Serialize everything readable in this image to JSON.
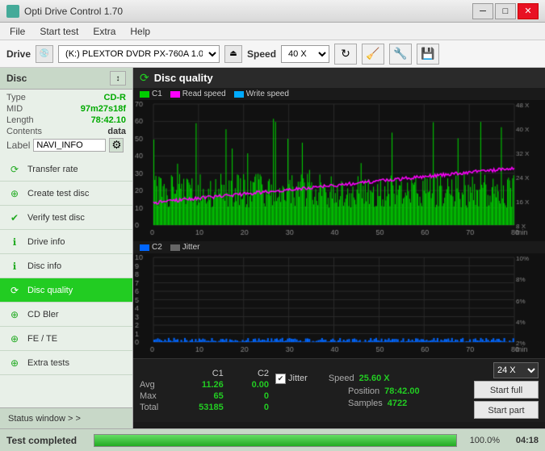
{
  "titleBar": {
    "icon": "💿",
    "title": "Opti Drive Control 1.70",
    "minimize": "─",
    "maximize": "□",
    "close": "✕"
  },
  "menuBar": {
    "items": [
      "File",
      "Start test",
      "Extra",
      "Help"
    ]
  },
  "driveBar": {
    "label": "Drive",
    "driveValue": "(K:)  PLEXTOR DVDR   PX-760A 1.07",
    "speedLabel": "Speed",
    "speedValue": "40 X"
  },
  "leftPanel": {
    "discHeader": "Disc",
    "discInfo": {
      "typeLabel": "Type",
      "typeValue": "CD-R",
      "midLabel": "MID",
      "midValue": "97m27s18f",
      "lengthLabel": "Length",
      "lengthValue": "78:42.10",
      "contentsLabel": "Contents",
      "contentsValue": "data",
      "labelLabel": "Label",
      "labelValue": "NAVI_INFO"
    },
    "navItems": [
      {
        "id": "transfer-rate",
        "label": "Transfer rate",
        "active": false
      },
      {
        "id": "create-test-disc",
        "label": "Create test disc",
        "active": false
      },
      {
        "id": "verify-test-disc",
        "label": "Verify test disc",
        "active": false
      },
      {
        "id": "drive-info",
        "label": "Drive info",
        "active": false
      },
      {
        "id": "disc-info",
        "label": "Disc info",
        "active": false
      },
      {
        "id": "disc-quality",
        "label": "Disc quality",
        "active": true
      },
      {
        "id": "cd-bler",
        "label": "CD Bler",
        "active": false
      },
      {
        "id": "fe-te",
        "label": "FE / TE",
        "active": false
      },
      {
        "id": "extra-tests",
        "label": "Extra tests",
        "active": false
      }
    ],
    "statusWindow": "Status window > >"
  },
  "discQuality": {
    "title": "Disc quality",
    "legend": {
      "c1": "C1",
      "readSpeed": "Read speed",
      "writeSpeed": "Write speed",
      "c2": "C2",
      "jitter": "Jitter"
    },
    "topChart": {
      "yMax": 70,
      "yMin": 0,
      "xMax": 80,
      "rightLabels": [
        "48 X",
        "40 X",
        "32 X",
        "24 X",
        "16 X",
        "8 X"
      ]
    },
    "bottomChart": {
      "yMax": 10,
      "yMin": 0,
      "xMax": 80,
      "rightLabels": [
        "10%",
        "8%",
        "6%",
        "4%",
        "2%"
      ]
    },
    "stats": {
      "headers": [
        "C1",
        "C2"
      ],
      "rows": [
        {
          "label": "Avg",
          "v1": "11.26",
          "v2": "0.00"
        },
        {
          "label": "Max",
          "v1": "65",
          "v2": "0"
        },
        {
          "label": "Total",
          "v1": "53185",
          "v2": "0"
        }
      ],
      "jitterLabel": "Jitter",
      "jitterChecked": true,
      "speedLabel": "Speed",
      "speedValue": "25.60 X",
      "positionLabel": "Position",
      "positionValue": "78:42.00",
      "samplesLabel": "Samples",
      "samplesValue": "4722"
    },
    "speedDropdown": "24 X",
    "startFull": "Start full",
    "startPart": "Start part"
  },
  "bottomBar": {
    "statusText": "Test completed",
    "progressPct": "100.0%",
    "time": "04:18"
  },
  "colors": {
    "green": "#22cc22",
    "magenta": "#ff00ff",
    "blue": "#0066ff",
    "darkBg": "#1a1a1a",
    "gridLine": "#2a2a2a"
  }
}
